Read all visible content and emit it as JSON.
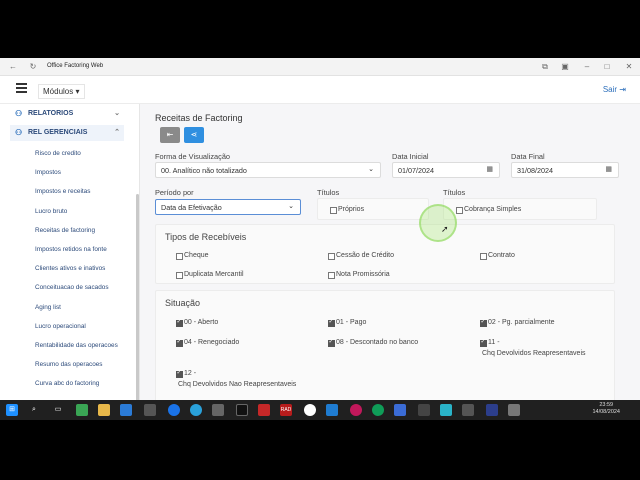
{
  "browser": {
    "title": "Office Factoring Web"
  },
  "header": {
    "modulos_label": "Módulos",
    "sair_label": "Sair"
  },
  "sidebar": {
    "sections": [
      {
        "label": "RELATORIOS"
      },
      {
        "label": "REL GERENCIAIS"
      }
    ],
    "items": [
      {
        "label": "Risco de credito"
      },
      {
        "label": "Impostos"
      },
      {
        "label": "Impostos e receitas"
      },
      {
        "label": "Lucro bruto"
      },
      {
        "label": "Receitas de factoring"
      },
      {
        "label": "Impostos retidos na fonte"
      },
      {
        "label": "Clientes ativos e inativos"
      },
      {
        "label": "Conceituacao de sacados"
      },
      {
        "label": "Aging list"
      },
      {
        "label": "Lucro operacional"
      },
      {
        "label": "Rentabilidade das operacoes"
      },
      {
        "label": "Resumo das operacoes"
      },
      {
        "label": "Curva abc do factoring"
      }
    ]
  },
  "main": {
    "title": "Receitas de Factoring",
    "forma": {
      "label": "Forma de Visualização",
      "value": "00. Analítico não totalizado"
    },
    "data_inicial": {
      "label": "Data Inicial",
      "value": "01/07/2024"
    },
    "data_final": {
      "label": "Data Final",
      "value": "31/08/2024"
    },
    "periodo": {
      "label": "Período por",
      "value": "Data da Efetivação"
    },
    "titulos1": {
      "label": "Títulos",
      "option": "Próprios"
    },
    "titulos2": {
      "label": "Títulos",
      "option": "Cobrança Simples"
    },
    "tipos": {
      "title": "Tipos de Recebíveis",
      "options": [
        "Cheque",
        "Cessão de Crédito",
        "Contrato",
        "Duplicata Mercantil",
        "Nota Promissória"
      ]
    },
    "situacao": {
      "title": "Situação",
      "options": [
        "00 - Aberto",
        "01 - Pago",
        "02 - Pg. parcialmente",
        "04 - Renegociado",
        "08 - Descontado no banco",
        "11 -",
        "Chq Devolvidos Reapresentaveis",
        "12 -",
        "Chq Devolvidos Nao Reapresentaveis"
      ]
    }
  },
  "taskbar": {
    "time": "23:59",
    "date": "14/08/2024"
  }
}
